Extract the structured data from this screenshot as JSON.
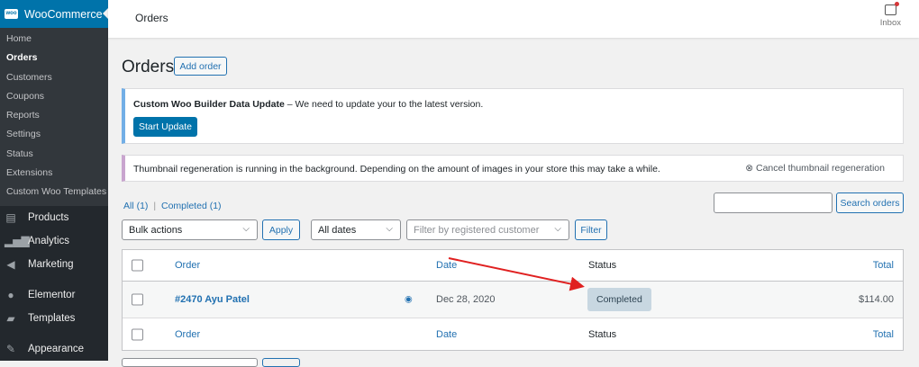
{
  "sidebar": {
    "woo_title": "WooCommerce",
    "woo_logo": "woo",
    "submenu": [
      "Home",
      "Orders",
      "Customers",
      "Coupons",
      "Reports",
      "Settings",
      "Status",
      "Extensions",
      "Custom Woo Templates"
    ],
    "menu": [
      {
        "label": "Products",
        "icon": "archive-icon"
      },
      {
        "label": "Analytics",
        "icon": "bar-chart-icon"
      },
      {
        "label": "Marketing",
        "icon": "megaphone-icon"
      },
      {
        "label": "Elementor",
        "icon": "elementor-icon"
      },
      {
        "label": "Templates",
        "icon": "folder-icon"
      },
      {
        "label": "Appearance",
        "icon": "paintbrush-icon"
      }
    ]
  },
  "topbar": {
    "title": "Orders",
    "inbox": "Inbox"
  },
  "page": {
    "title": "Orders",
    "add_order": "Add order"
  },
  "notice1": {
    "bold": "Custom Woo Builder Data Update",
    "text": " – We need to update your to the latest version.",
    "button": "Start Update"
  },
  "notice2": {
    "text": "Thumbnail regeneration is running in the background. Depending on the amount of images in your store this may take a while.",
    "cancel": "Cancel thumbnail regeneration"
  },
  "filters": {
    "all": "All (1)",
    "sep": "|",
    "completed": "Completed (1)",
    "search_button": "Search orders",
    "search_value": "",
    "bulk": "Bulk actions",
    "apply": "Apply",
    "dates": "All dates",
    "customer_placeholder": "Filter by registered customer",
    "filter": "Filter"
  },
  "table": {
    "headers": {
      "order": "Order",
      "date": "Date",
      "status": "Status",
      "total": "Total"
    },
    "rows": [
      {
        "order": "#2470 Ayu Patel",
        "date": "Dec 28, 2020",
        "status": "Completed",
        "total": "$114.00"
      }
    ]
  },
  "colors": {
    "accent": "#2271b1",
    "arrow": "#e02020"
  }
}
